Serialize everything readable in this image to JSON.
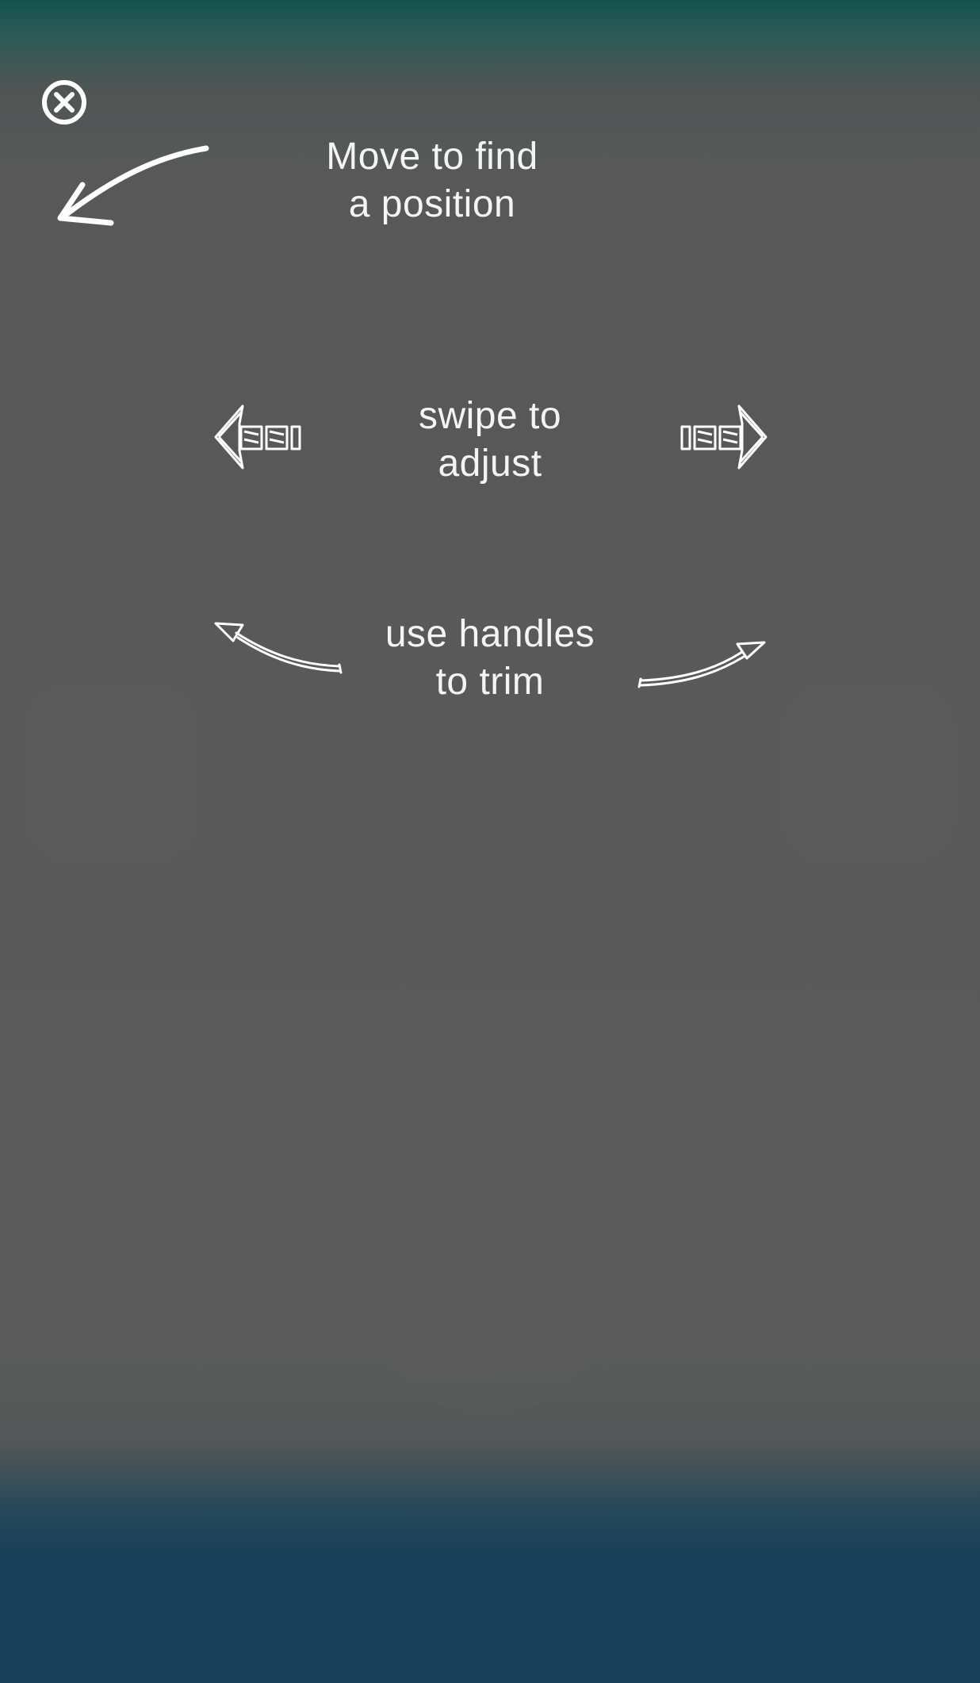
{
  "overlay": {
    "close_icon": "close-circle-icon",
    "hints": {
      "move": {
        "line1": "Move to find",
        "line2": "a position"
      },
      "swipe": {
        "line1": "swipe to",
        "line2": "adjust"
      },
      "trim": {
        "line1": "use handles",
        "line2": "to trim"
      }
    },
    "icons": {
      "move_arrow": "curved-arrow-down-left-icon",
      "swipe_left": "sketch-arrow-left-icon",
      "swipe_right": "sketch-arrow-right-icon",
      "trim_left": "curved-arrow-up-left-icon",
      "trim_right": "curved-arrow-up-right-icon"
    },
    "colors": {
      "top_accent": "#13534c",
      "overlay_gray": "#5a5a5a",
      "bottom_accent": "#193f58",
      "hint_text": "#f4f4f4"
    }
  }
}
